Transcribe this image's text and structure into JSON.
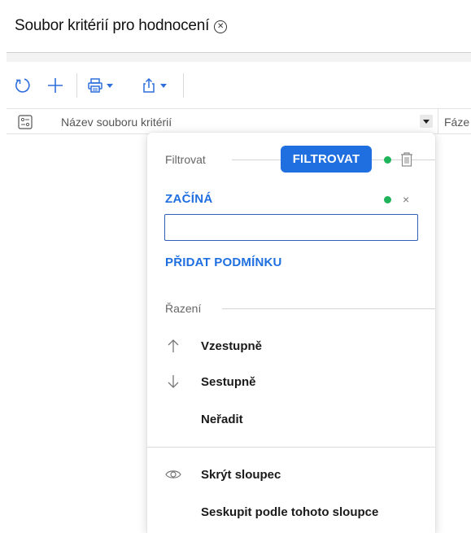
{
  "window": {
    "title": "Soubor kritérií pro hodnocení"
  },
  "grid": {
    "columns": [
      {
        "label": "Název souboru kritérií"
      },
      {
        "label": "Fáze"
      }
    ]
  },
  "column_menu": {
    "filter_section_label": "Filtrovat",
    "filter_button_label": "FILTROVAT",
    "condition": {
      "operator": "ZAČÍNÁ",
      "value": "",
      "remove_glyph": "×"
    },
    "add_condition_label": "PŘIDAT PODMÍNKU",
    "sort_section_label": "Řazení",
    "sort_options": [
      {
        "label": "Vzestupně",
        "icon": "arrow-up-icon"
      },
      {
        "label": "Sestupně",
        "icon": "arrow-down-icon"
      },
      {
        "label": "Neřadit"
      }
    ],
    "actions": [
      {
        "label": "Skrýt sloupec",
        "icon": "eye-icon"
      },
      {
        "label": "Seskupit podle tohoto sloupce"
      }
    ]
  },
  "colors": {
    "accent": "#1f6fe0",
    "active_dot": "#1fb35a"
  }
}
